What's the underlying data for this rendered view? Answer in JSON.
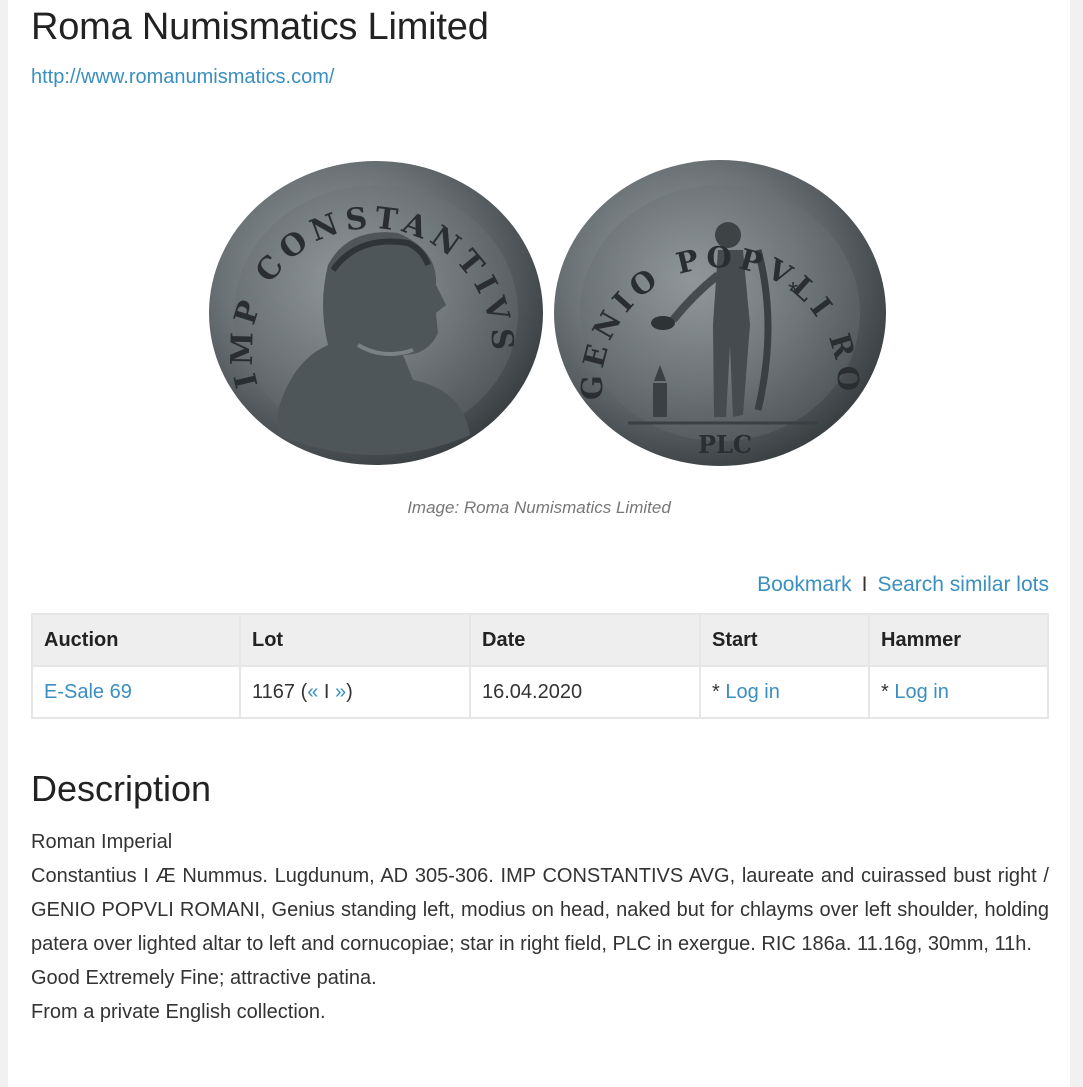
{
  "header": {
    "title": "Roma Numismatics Limited",
    "url": "http://www.romanumismatics.com/"
  },
  "image": {
    "caption": "Image: Roma Numismatics Limited",
    "obverse_legend": "IMP CONSTANTIVS AVG",
    "reverse_legend": "GENIO POPVLI ROMANI",
    "exergue": "PLC"
  },
  "actions": {
    "bookmark": "Bookmark",
    "separator": "I",
    "search_similar": "Search similar lots"
  },
  "table": {
    "headers": [
      "Auction",
      "Lot",
      "Date",
      "Start",
      "Hammer"
    ],
    "row": {
      "auction": "E-Sale 69",
      "lot_number": "1167 (",
      "lot_prev": "«",
      "lot_sep": " I ",
      "lot_next": "»",
      "lot_close": ")",
      "date": "16.04.2020",
      "start_prefix": "* ",
      "start_link": "Log in",
      "hammer_prefix": "* ",
      "hammer_link": "Log in"
    }
  },
  "description": {
    "heading": "Description",
    "category": "Roman Imperial",
    "text": "Constantius I Æ Nummus. Lugdunum, AD 305-306. IMP CONSTANTIVS AVG, laureate and cuirassed bust right / GENIO POPVLI ROMANI, Genius standing left, modius on head, naked but for chlayms over left shoulder, holding patera over lighted altar to left and cornucopiae; star in right field, PLC in exergue. RIC 186a. 11.16g, 30mm, 11h.",
    "grade": "Good Extremely Fine; attractive patina.",
    "provenance": "From a private English collection."
  },
  "colors": {
    "link": "#3a8fc0",
    "header_bg": "#eeeeee",
    "coin_dark": "#3b4043",
    "coin_light": "#8d9497"
  }
}
